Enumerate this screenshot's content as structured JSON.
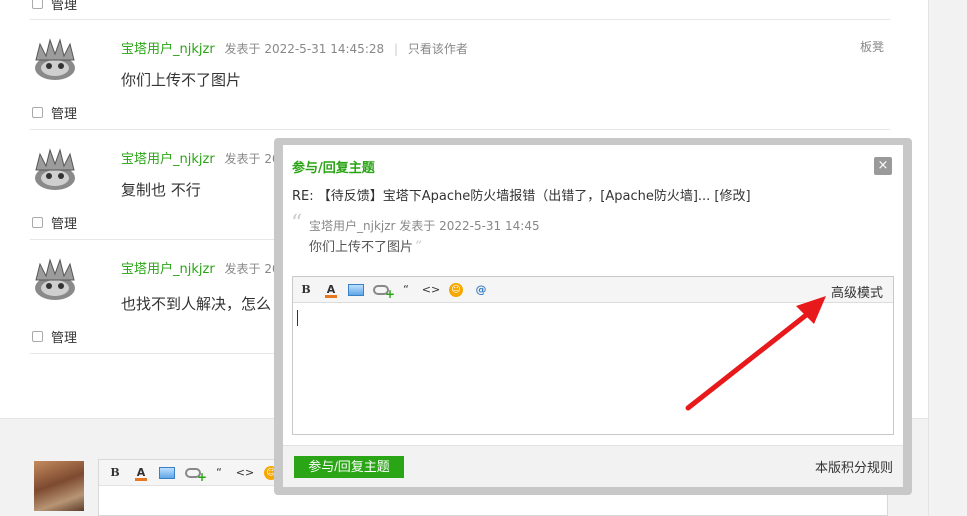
{
  "posts": [
    {
      "author": "宝塔用户_njkjzr",
      "posted": "发表于 2022-5-31 14:45:28",
      "only_author": "只看该作者",
      "floor": "板凳",
      "content": "你们上传不了图片",
      "manage": "管理"
    },
    {
      "author": "宝塔用户_njkjzr",
      "posted": "发表于 202",
      "content": "复制也 不行",
      "manage": "管理"
    },
    {
      "author": "宝塔用户_njkjzr",
      "posted": "发表于 202",
      "content": "也找不到人解决，怎么",
      "manage": "管理"
    }
  ],
  "top_manage": "管理",
  "dialog": {
    "title": "参与/回复主题",
    "close": "×",
    "subject": "RE: 【待反馈】宝塔下Apache防火墙报错（出错了，[Apache防火墙]... [修改]",
    "quote_meta": "宝塔用户_njkjzr 发表于 2022-5-31 14:45",
    "quote_text": "你们上传不了图片",
    "quote_open": "“",
    "quote_close": "”",
    "advanced_mode": "高级模式",
    "submit": "参与/回复主题",
    "rules": "本版积分规则"
  },
  "toolbar": {
    "bold": "B",
    "color": "A",
    "quote": "“",
    "code": "<>",
    "emoji": "☺",
    "at": "@"
  },
  "colors": {
    "brand_green": "#2aa515",
    "arrow_red": "#e8191b"
  }
}
